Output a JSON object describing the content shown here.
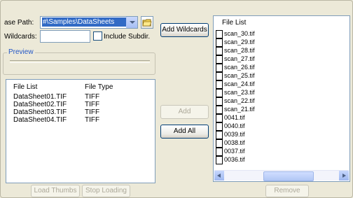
{
  "base_path": {
    "label": "ase Path:",
    "value": "#\\Samples\\DataSheets"
  },
  "wildcards": {
    "label": "Wildcards:",
    "value": ""
  },
  "include_subdirs": {
    "label": "Include Subdir."
  },
  "preview": {
    "title": "Preview"
  },
  "preview_list": {
    "columns": [
      "File List",
      "File Type"
    ],
    "rows": [
      {
        "name": "DataSheet01.TIF",
        "type": "TIFF"
      },
      {
        "name": "DataSheet02.TIF",
        "type": "TIFF"
      },
      {
        "name": "DataSheet03.TIF",
        "type": "TIFF"
      },
      {
        "name": "DataSheet04.TIF",
        "type": "TIFF"
      }
    ]
  },
  "buttons": {
    "add_wildcards": "Add Wildcards",
    "add": "Add",
    "add_all": "Add All",
    "load_thumbs": "Load Thumbs",
    "stop_loading": "Stop Loading",
    "remove": "Remove"
  },
  "right_list": {
    "title": "File List",
    "files": [
      "scan_30.tif",
      "scan_29.tif",
      "scan_28.tif",
      "scan_27.tif",
      "scan_26.tif",
      "scan_25.tif",
      "scan_24.tif",
      "scan_23.tif",
      "scan_22.tif",
      "scan_21.tif",
      "0041.tif",
      "0040.tif",
      "0039.tif",
      "0038.tif",
      "0037.tif",
      "0036.tif"
    ]
  },
  "colors": {
    "selection": "#316ac5",
    "group_title": "#2256c6",
    "window_bg": "#ece9d8"
  }
}
